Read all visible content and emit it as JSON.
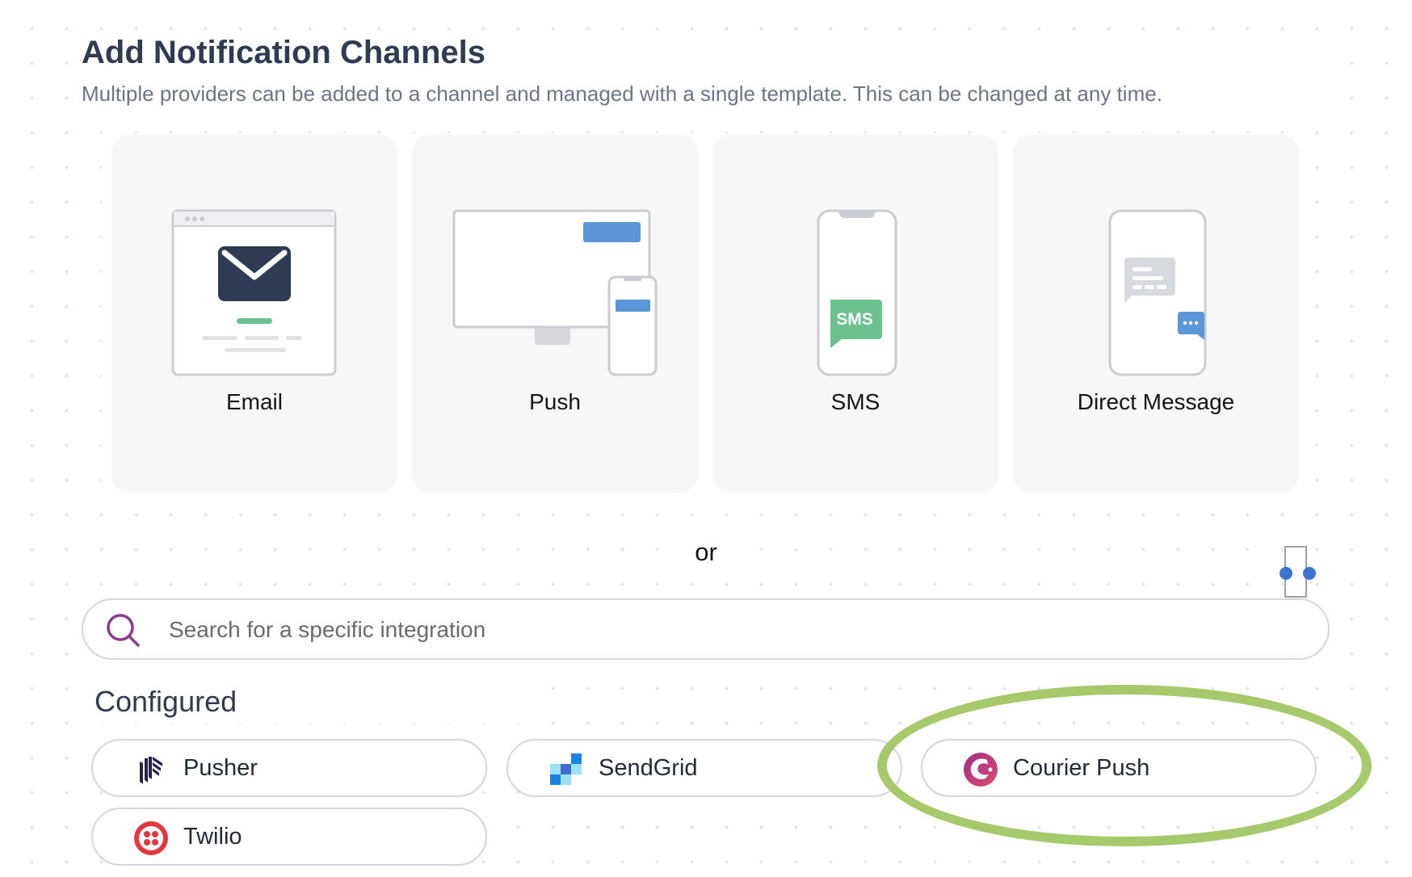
{
  "header": {
    "title": "Add Notification Channels",
    "subtitle": "Multiple providers can be added to a channel and managed with a single template. This can be changed at any time."
  },
  "channels": [
    {
      "label": "Email",
      "icon": "email-illustration-icon"
    },
    {
      "label": "Push",
      "icon": "push-illustration-icon"
    },
    {
      "label": "SMS",
      "icon": "sms-illustration-icon",
      "badge_text": "SMS"
    },
    {
      "label": "Direct Message",
      "icon": "direct-message-illustration-icon"
    }
  ],
  "divider": {
    "text": "or"
  },
  "search": {
    "placeholder": "Search for a specific integration",
    "value": "",
    "icon": "search-icon"
  },
  "configured": {
    "heading": "Configured",
    "integrations": [
      {
        "name": "Pusher",
        "icon": "pusher-logo-icon"
      },
      {
        "name": "SendGrid",
        "icon": "sendgrid-logo-icon"
      },
      {
        "name": "Courier Push",
        "icon": "courier-logo-icon"
      },
      {
        "name": "Twilio",
        "icon": "twilio-logo-icon"
      }
    ]
  },
  "colors": {
    "title": "#2f3b52",
    "card_background": "#f7f7f8",
    "sms_green": "#6cc28f",
    "push_blue": "#5b97d8",
    "annotation_green": "#a5c96b",
    "search_icon_purple": "#8a3d8c"
  }
}
